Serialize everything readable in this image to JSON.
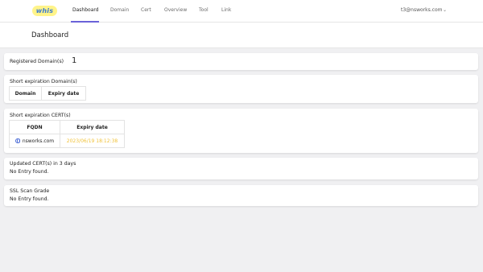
{
  "app": {
    "logo_text": "whis"
  },
  "nav": {
    "items": [
      {
        "label": "Dashboard"
      },
      {
        "label": "Domain"
      },
      {
        "label": "Cert"
      },
      {
        "label": "Overview"
      },
      {
        "label": "Tool"
      },
      {
        "label": "Link"
      }
    ]
  },
  "user": {
    "email": "t3@nsworks.com",
    "caret": "⌄"
  },
  "page": {
    "title": "Dashboard"
  },
  "registered": {
    "label": "Registered Domain(s)",
    "count": "1"
  },
  "short_domains": {
    "label": "Short expiration Domain(s)",
    "columns": [
      "Domain",
      "Expiry date"
    ]
  },
  "short_certs": {
    "label": "Short expiration CERT(s)",
    "columns": [
      "FQDN",
      "Expiry date"
    ],
    "rows": [
      {
        "fqdn": "nsworks.com",
        "expiry": "2023/06/19 18:12:38"
      }
    ],
    "colors": {
      "expiry_warning": "#f0c23a",
      "globe": "#4a6bd6"
    }
  },
  "updated_certs": {
    "label": "Updated CERT(s) in 3 days",
    "empty": "No Entry found."
  },
  "ssl_scan": {
    "label": "SSL Scan Grade",
    "empty": "No Entry found."
  },
  "colors": {
    "accent": "#6a62d8",
    "logo_bg": "#fff48a",
    "logo_text": "#3b7bd0"
  }
}
